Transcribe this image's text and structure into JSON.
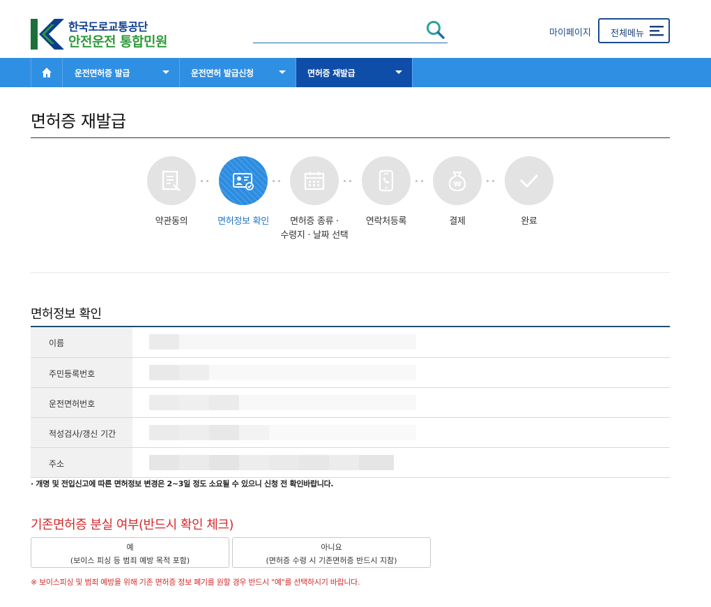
{
  "header": {
    "logo_top": "한국도로교통공단",
    "logo_bottom": "안전운전 통합민원",
    "search_placeholder": "",
    "mypage_label": "마이페이지",
    "allmenu_label": "전체메뉴",
    "icons": {
      "search": "search-icon",
      "menu": "hamburger-icon"
    },
    "accent_color": "#1a4b8c"
  },
  "nav": {
    "home_icon": "home-icon",
    "items": [
      {
        "label": "운전면허증 발급"
      },
      {
        "label": "운전면허 발급신청"
      },
      {
        "label": "면허증 재발급",
        "active": true
      }
    ],
    "bar_color": "#2f8fe3",
    "active_color": "#0e4ea8"
  },
  "page": {
    "title": "면허증 재발급"
  },
  "steps": [
    {
      "label": "약관동의",
      "icon": "document-edit-icon"
    },
    {
      "label": "면허정보 확인",
      "icon": "id-card-check-icon",
      "active": true
    },
    {
      "label_line1": "면허증 종류 ·",
      "label_line2": "수령지 · 날짜 선택",
      "icon": "calendar-icon"
    },
    {
      "label": "연락처등록",
      "icon": "phone-icon"
    },
    {
      "label": "결제",
      "icon": "money-bag-icon"
    },
    {
      "label": "완료",
      "icon": "check-icon"
    }
  ],
  "license_info": {
    "title": "면허정보 확인",
    "rows": [
      {
        "label": "이름",
        "value": ""
      },
      {
        "label": "주민등록번호",
        "value": ""
      },
      {
        "label": "운전면허번호",
        "value": ""
      },
      {
        "label": "적성검사/갱신 기간",
        "value": ""
      },
      {
        "label": "주소",
        "value": ""
      }
    ],
    "notice": "· 개명 및 전입신고에 따른 면허정보 변경은 2~3일 정도 소요될 수 있으니 신청 전 확인바랍니다."
  },
  "lost_check": {
    "title": "기존면허증 분실 여부(반드시 확인 체크)",
    "yes_label": "예",
    "yes_sub": "(보이스 피싱 등 범죄 예방 목적 포함)",
    "no_label": "아니요",
    "no_sub": "(면허증 수령 시 기존면허증 반드시 지참)",
    "warning": "※ 보이스피싱 및 범죄 예방을 위해 기존 면허증 정보 폐기를 원할 경우 반드시 \"예\"를 선택하시기 바랍니다.",
    "warning_color": "#d4282a"
  }
}
